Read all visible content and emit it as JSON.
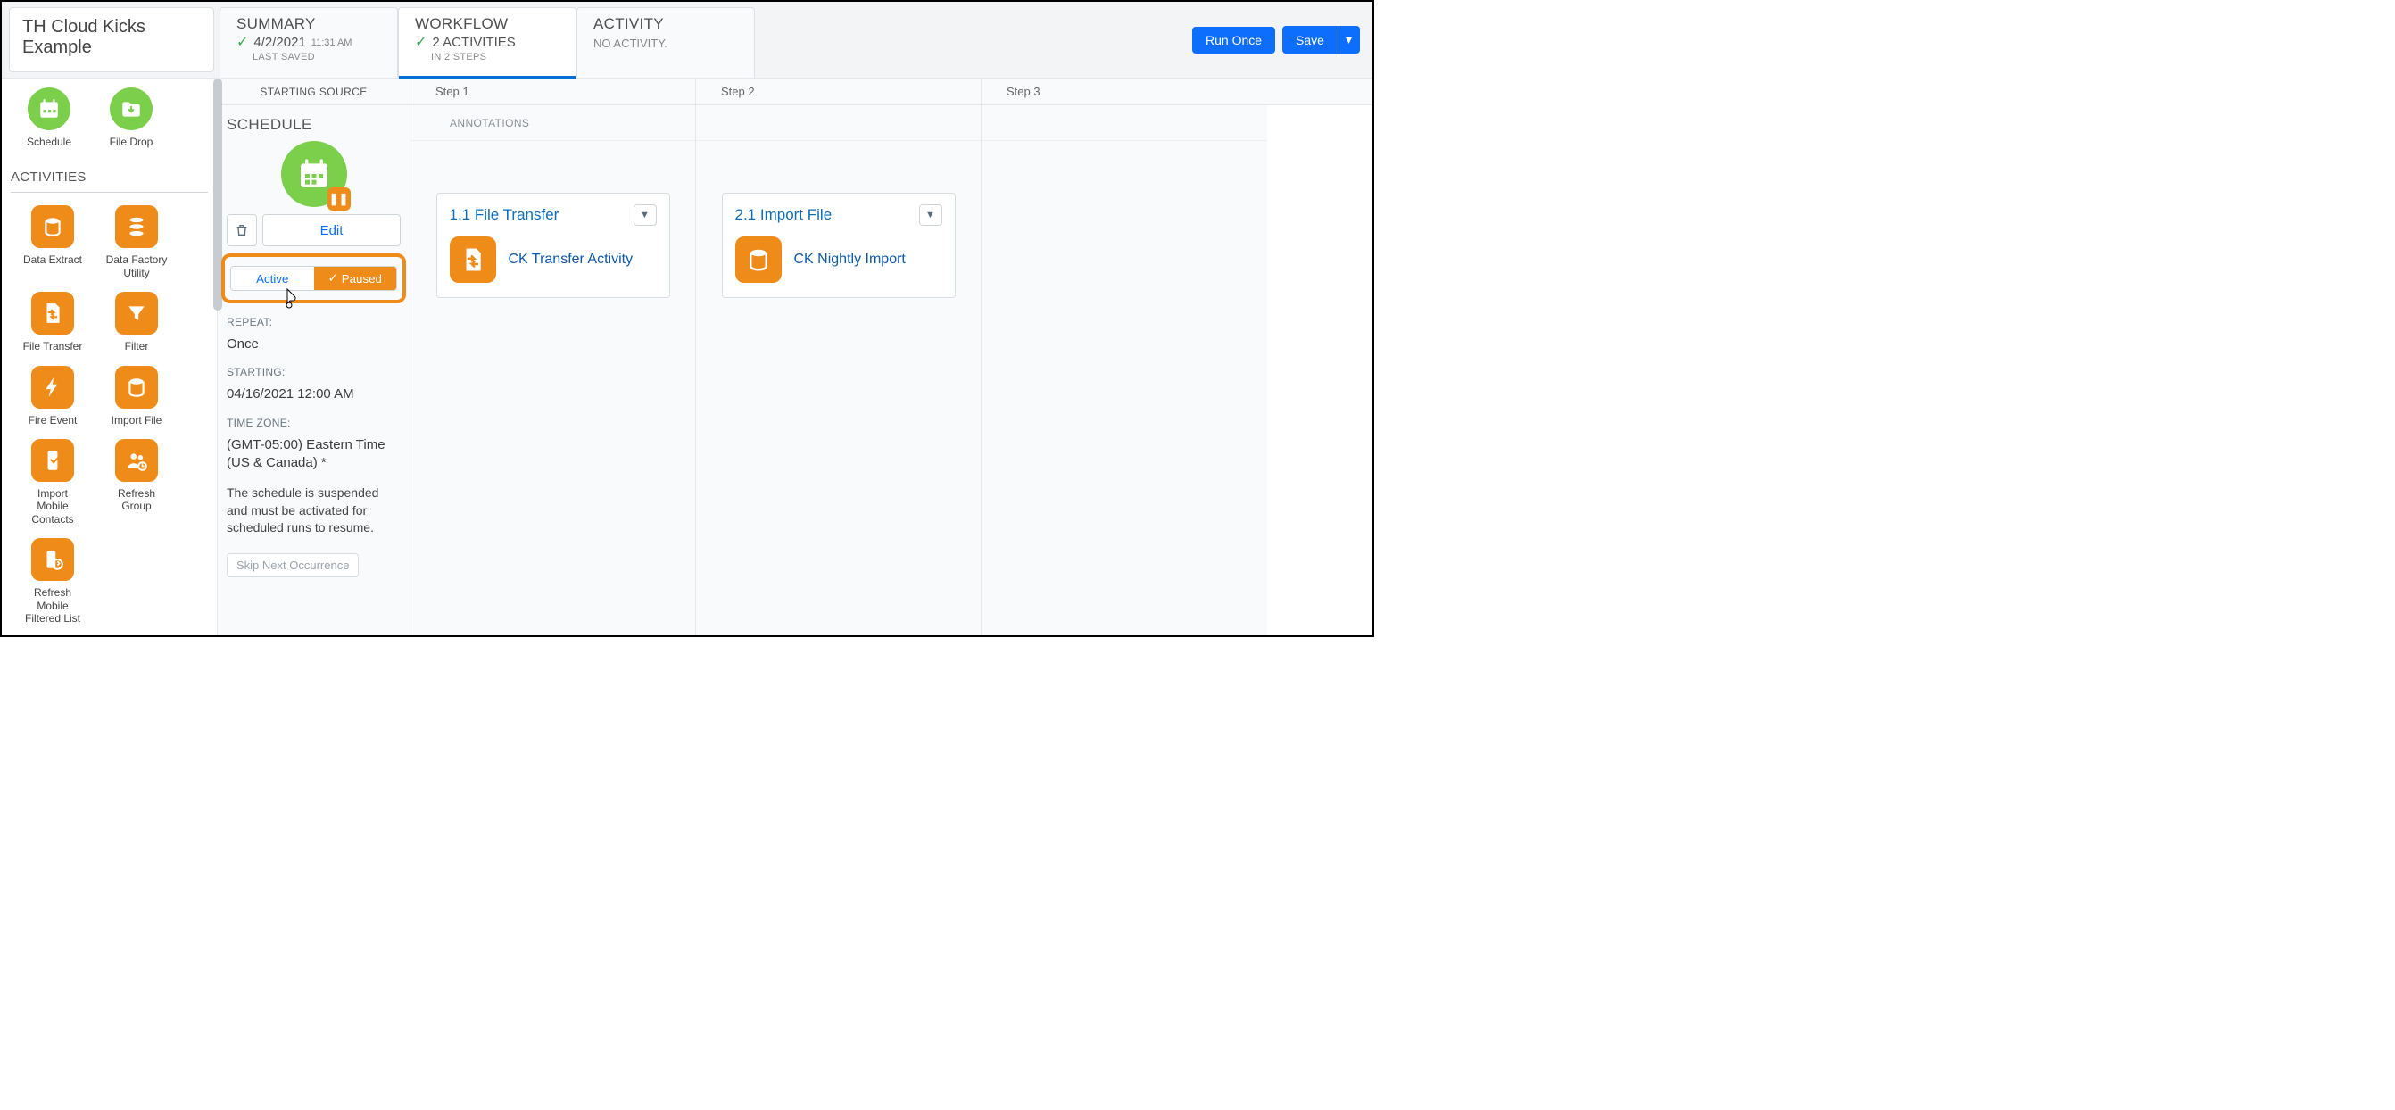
{
  "header": {
    "title": "TH Cloud Kicks Example",
    "tabs": {
      "summary": {
        "label": "SUMMARY",
        "date": "4/2/2021",
        "time": "11:31 AM",
        "note": "LAST SAVED"
      },
      "workflow": {
        "label": "WORKFLOW",
        "count": "2 ACTIVITIES",
        "note": "IN 2 STEPS"
      },
      "activity": {
        "label": "ACTIVITY",
        "note": "NO ACTIVITY."
      }
    },
    "actions": {
      "run_once": "Run Once",
      "save": "Save"
    }
  },
  "sidebar": {
    "starters": {
      "schedule": "Schedule",
      "file_drop": "File Drop"
    },
    "activities_label": "ACTIVITIES",
    "items": {
      "data_extract": "Data Extract",
      "data_factory": "Data Factory Utility",
      "file_transfer": "File Transfer",
      "filter": "Filter",
      "fire_event": "Fire Event",
      "import_file": "Import File",
      "import_mobile": "Import Mobile Contacts",
      "refresh_group": "Refresh Group",
      "refresh_mobile": "Refresh Mobile Filtered List"
    }
  },
  "canvas": {
    "starting_source_label": "STARTING SOURCE",
    "steps": {
      "s1": "Step 1",
      "s2": "Step 2",
      "s3": "Step 3"
    },
    "annotations_label": "ANNOTATIONS",
    "source": {
      "heading": "SCHEDULE",
      "edit": "Edit",
      "toggle": {
        "active": "Active",
        "paused": "Paused"
      },
      "repeat_label": "REPEAT:",
      "repeat_value": "Once",
      "starting_label": "STARTING:",
      "starting_value": "04/16/2021 12:00 AM",
      "tz_label": "TIME ZONE:",
      "tz_value": "(GMT-05:00) Eastern Time (US & Canada) *",
      "suspend_note": "The schedule is suspended and must be activated for scheduled runs to resume.",
      "skip_label": "Skip Next Occurrence"
    },
    "step1_card": {
      "title": "1.1 File Transfer",
      "label": "CK Transfer Activity"
    },
    "step2_card": {
      "title": "2.1 Import File",
      "label": "CK Nightly Import"
    }
  }
}
